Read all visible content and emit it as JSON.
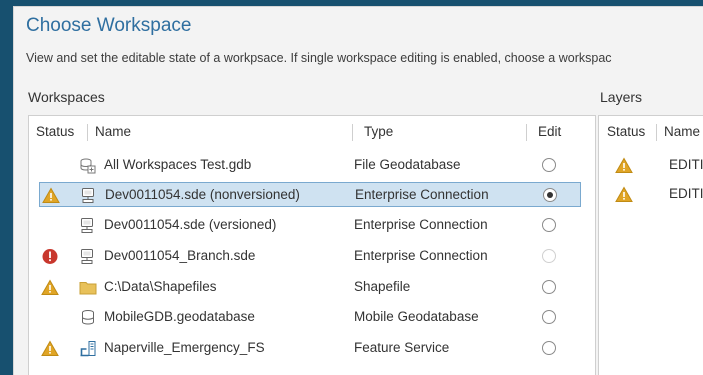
{
  "dialog": {
    "title": "Choose Workspace",
    "description": "View and set the editable state of a workpsace.  If single workspace editing is enabled, choose a workspac"
  },
  "workspaces": {
    "label": "Workspaces",
    "columns": {
      "status": "Status",
      "name": "Name",
      "type": "Type",
      "edit": "Edit"
    },
    "rows": [
      {
        "status": "",
        "icon": "file-geodatabase-icon",
        "name": "All Workspaces Test.gdb",
        "type": "File Geodatabase",
        "edit": "unchecked",
        "selected": false
      },
      {
        "status": "warning",
        "icon": "database-connection-icon",
        "name": "Dev0011054.sde (nonversioned)",
        "type": "Enterprise Connection",
        "edit": "checked",
        "selected": true
      },
      {
        "status": "",
        "icon": "database-connection-icon",
        "name": "Dev0011054.sde (versioned)",
        "type": "Enterprise Connection",
        "edit": "unchecked",
        "selected": false
      },
      {
        "status": "error",
        "icon": "database-connection-icon",
        "name": "Dev0011054_Branch.sde",
        "type": "Enterprise Connection",
        "edit": "disabled",
        "selected": false
      },
      {
        "status": "warning",
        "icon": "folder-icon",
        "name": "C:\\Data\\Shapefiles",
        "type": "Shapefile",
        "edit": "unchecked",
        "selected": false
      },
      {
        "status": "",
        "icon": "mobile-geodatabase-icon",
        "name": "MobileGDB.geodatabase",
        "type": "Mobile Geodatabase",
        "edit": "unchecked",
        "selected": false
      },
      {
        "status": "warning",
        "icon": "feature-service-icon",
        "name": "Naperville_Emergency_FS",
        "type": "Feature Service",
        "edit": "unchecked",
        "selected": false
      }
    ]
  },
  "layers": {
    "label": "Layers",
    "columns": {
      "status": "Status",
      "name": "Name"
    },
    "rows": [
      {
        "status": "warning",
        "name": "EDITIN"
      },
      {
        "status": "warning",
        "name": "EDITIN"
      }
    ]
  },
  "colors": {
    "accent": "#2f6fa0",
    "selection": "#cfe2f1",
    "warning": "#e0a526",
    "error": "#c8372d"
  }
}
